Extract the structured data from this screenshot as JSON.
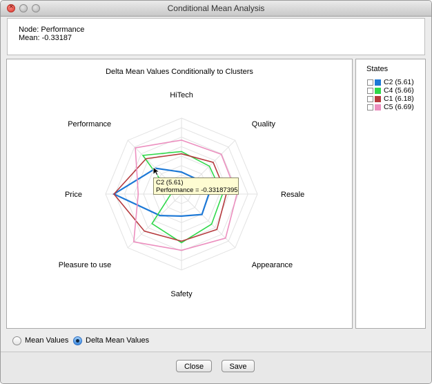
{
  "window": {
    "title": "Conditional Mean Analysis"
  },
  "info": {
    "node_line": "Node: Performance",
    "mean_line": "Mean: -0.33187"
  },
  "states": {
    "title": "States",
    "items": [
      {
        "label": "C2 (5.61)",
        "color": "#1c78d6"
      },
      {
        "label": "C4 (5.66)",
        "color": "#2fd84a"
      },
      {
        "label": "C1 (6.18)",
        "color": "#b53a3e"
      },
      {
        "label": "C5 (6.69)",
        "color": "#ec8fbf"
      }
    ]
  },
  "chart_data": {
    "type": "radar",
    "title": "Delta Mean Values Conditionally to Clusters",
    "categories": [
      "HiTech",
      "Quality",
      "Resale",
      "Appearance",
      "Safety",
      "Pleasure to use",
      "Price",
      "Performance"
    ],
    "series": [
      {
        "name": "C2 (5.61)",
        "color": "#1c78d6",
        "values": [
          0.29,
          0.28,
          0.36,
          0.38,
          0.29,
          0.4,
          0.89,
          0.48
        ]
      },
      {
        "name": "C4 (5.66)",
        "color": "#2fd84a",
        "values": [
          0.56,
          0.52,
          0.54,
          0.56,
          0.64,
          0.55,
          0.14,
          0.72
        ]
      },
      {
        "name": "C1 (6.18)",
        "color": "#b53a3e",
        "values": [
          0.53,
          0.59,
          0.59,
          0.66,
          0.62,
          0.69,
          0.89,
          0.66
        ]
      },
      {
        "name": "C5 (6.69)",
        "color": "#ec8fbf",
        "values": [
          0.71,
          0.74,
          0.73,
          0.82,
          0.74,
          0.89,
          0.57,
          0.86
        ]
      }
    ]
  },
  "tooltip": {
    "line1": "C2 (5.61)",
    "line2": "Performance = -0.33187395"
  },
  "view": {
    "options": [
      {
        "label": "Mean Values",
        "selected": false
      },
      {
        "label": "Delta Mean Values",
        "selected": true
      }
    ]
  },
  "buttons": {
    "close": "Close",
    "save": "Save"
  }
}
